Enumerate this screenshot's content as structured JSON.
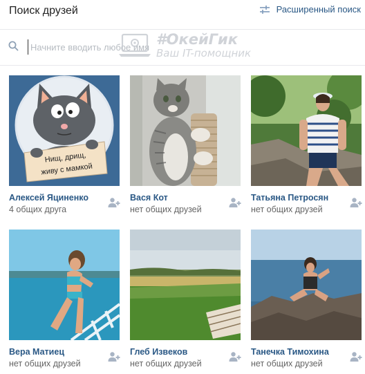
{
  "header": {
    "title": "Поиск друзей",
    "advanced_search_label": "Расширенный поиск",
    "advanced_search_icon": "sliders-icon"
  },
  "search": {
    "placeholder": "Начните вводить любое имя",
    "value": "",
    "icon": "search-icon"
  },
  "watermark": {
    "line1": "#ОкейГик",
    "line2": "Ваш IT-помощник"
  },
  "friends": [
    {
      "name": "Алексей Яциненко",
      "mutual": "4 общих друга",
      "photo_sign": [
        "Нищ, дрищ,",
        "живу с мамкой"
      ]
    },
    {
      "name": "Вася Кот",
      "mutual": "нет общих друзей"
    },
    {
      "name": "Татьяна Петросян",
      "mutual": "нет общих друзей"
    },
    {
      "name": "Вера Матиец",
      "mutual": "нет общих друзей"
    },
    {
      "name": "Глеб Извеков",
      "mutual": "нет общих друзей"
    },
    {
      "name": "Танечка Тимохина",
      "mutual": "нет общих друзей"
    }
  ],
  "colors": {
    "link": "#2a5885",
    "secondary_text": "#656565",
    "icon": "#a8b4c4",
    "divider": "#e7e8ec"
  }
}
